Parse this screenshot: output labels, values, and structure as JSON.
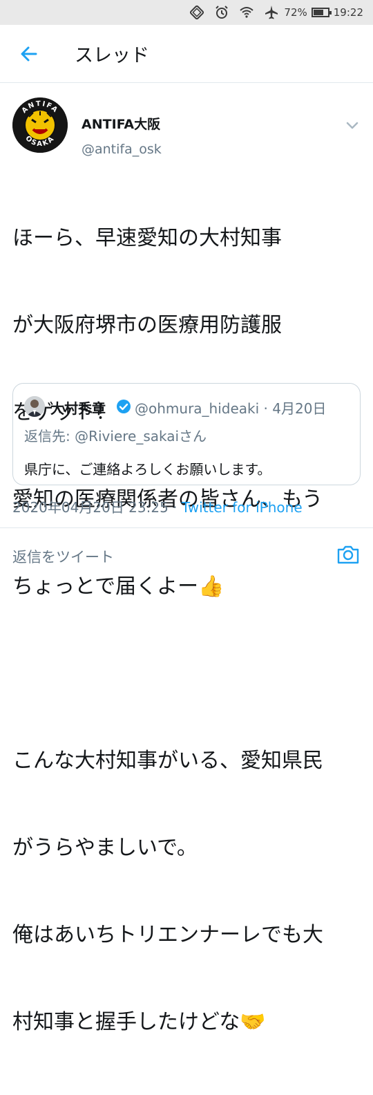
{
  "status_bar": {
    "battery": "72%",
    "battery_level": 0.72,
    "time": "19:22",
    "icons": [
      "screen-rotate-icon",
      "alarm-icon",
      "wifi-icon",
      "airplane-icon",
      "battery-icon"
    ]
  },
  "header": {
    "title": "スレッド",
    "back_icon": "arrow-left-icon"
  },
  "tweet": {
    "author_name": "ANTIFA大阪",
    "author_handle": "@antifa_osk",
    "avatar_text_top": "ANTIFA",
    "avatar_text_bottom": "OSAKA",
    "text_lines": [
      "ほーら、早速愛知の大村知事",
      "が大阪府堺市の医療用防護服",
      "をゲット！",
      "愛知の医療関係者の皆さん、もう",
      "ちょっとで届くよー",
      "",
      "こんな大村知事がいる、愛知県民",
      "がうらやましいで。",
      "俺はあいちトリエンナーレでも大",
      "村知事と握手したけどな"
    ],
    "emoji_thumbs": "👍",
    "emoji_handshake": "🤝",
    "timestamp": "2020年04月20日 23:25",
    "separator": " · ",
    "source": "Twitter for iPhone"
  },
  "quote": {
    "name": "大村秀章",
    "handle_date": "@ohmura_hideaki · 4月20日",
    "reply_to": "返信先: @Riviere_sakaiさん",
    "text": "県庁に、ご連絡よろしくお願いします。",
    "verified": true
  },
  "reply_bar": {
    "placeholder": "返信をツイート",
    "camera_icon": "camera-icon"
  },
  "colors": {
    "accent": "#1da1f2",
    "text": "#14171a",
    "secondary": "#657786",
    "border": "#e1e8ed"
  }
}
